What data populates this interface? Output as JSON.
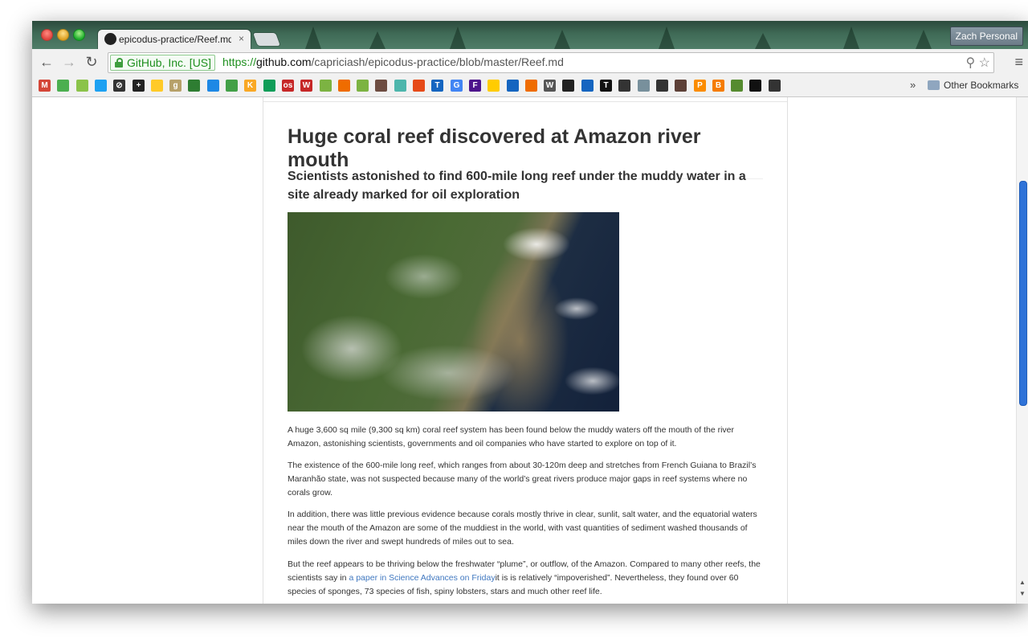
{
  "tab": {
    "title": "epicodus-practice/Reef.md",
    "close": "×"
  },
  "profile": {
    "label": "Zach Personal"
  },
  "toolbar": {
    "back": "←",
    "forward": "→",
    "reload": "↻",
    "menu": "≡"
  },
  "address": {
    "ev_label": "GitHub, Inc. [US]",
    "scheme": "https://",
    "host": "github.com",
    "path": "/capriciash/epicodus-practice/blob/master/Reef.md",
    "icons": "⚲ ☆"
  },
  "bookmarks": {
    "items": [
      {
        "name": "gmail",
        "glyph": "M",
        "color": "#d44638"
      },
      {
        "name": "maps",
        "glyph": "",
        "color": "#4caf50"
      },
      {
        "name": "android",
        "glyph": "",
        "color": "#8bc34a"
      },
      {
        "name": "twitter",
        "glyph": "",
        "color": "#1da1f2"
      },
      {
        "name": "circle-slash",
        "glyph": "⊘",
        "color": "#333"
      },
      {
        "name": "plus-app",
        "glyph": "+",
        "color": "#222"
      },
      {
        "name": "yellow-app",
        "glyph": "",
        "color": "#ffca28"
      },
      {
        "name": "goodreads",
        "glyph": "g",
        "color": "#b7a16a"
      },
      {
        "name": "green-book",
        "glyph": "",
        "color": "#2e7d32"
      },
      {
        "name": "blue-square",
        "glyph": "",
        "color": "#1e88e5"
      },
      {
        "name": "evernote",
        "glyph": "",
        "color": "#43a047"
      },
      {
        "name": "kmd",
        "glyph": "K",
        "color": "#f9a825"
      },
      {
        "name": "sheets",
        "glyph": "",
        "color": "#0f9d58"
      },
      {
        "name": "os-app",
        "glyph": "os",
        "color": "#c62828"
      },
      {
        "name": "w-red",
        "glyph": "W",
        "color": "#c62828"
      },
      {
        "name": "arc-app",
        "glyph": "",
        "color": "#7cb342"
      },
      {
        "name": "fox-app",
        "glyph": "",
        "color": "#ef6c00"
      },
      {
        "name": "shopify",
        "glyph": "",
        "color": "#7cb342"
      },
      {
        "name": "bird-app",
        "glyph": "",
        "color": "#6d4c41"
      },
      {
        "name": "cloud-app",
        "glyph": "",
        "color": "#4db6ac"
      },
      {
        "name": "spiral-app",
        "glyph": "",
        "color": "#e64a19"
      },
      {
        "name": "tl-app",
        "glyph": "T",
        "color": "#1565c0"
      },
      {
        "name": "google",
        "glyph": "G",
        "color": "#4285f4"
      },
      {
        "name": "fedex",
        "glyph": "F",
        "color": "#4d148c"
      },
      {
        "name": "dhl",
        "glyph": "",
        "color": "#ffcc00"
      },
      {
        "name": "mail-app",
        "glyph": "",
        "color": "#1565c0"
      },
      {
        "name": "box-app",
        "glyph": "",
        "color": "#ef6c00"
      },
      {
        "name": "wikipedia",
        "glyph": "W",
        "color": "#555"
      },
      {
        "name": "circle-app",
        "glyph": "",
        "color": "#222"
      },
      {
        "name": "robot-app",
        "glyph": "",
        "color": "#1565c0"
      },
      {
        "name": "nyt",
        "glyph": "T",
        "color": "#111"
      },
      {
        "name": "pin-app",
        "glyph": "",
        "color": "#333"
      },
      {
        "name": "slash-app",
        "glyph": "",
        "color": "#78909c"
      },
      {
        "name": "bike-app",
        "glyph": "",
        "color": "#333"
      },
      {
        "name": "stamp-app",
        "glyph": "",
        "color": "#5d4037"
      },
      {
        "name": "p-app",
        "glyph": "P",
        "color": "#fb8c00"
      },
      {
        "name": "blogger",
        "glyph": "B",
        "color": "#f57c00"
      },
      {
        "name": "puzzle-app",
        "glyph": "",
        "color": "#558b2f"
      },
      {
        "name": "black-square",
        "glyph": "",
        "color": "#111"
      },
      {
        "name": "octocat",
        "glyph": "",
        "color": "#333"
      }
    ],
    "more": "»",
    "other_label": "Other Bookmarks"
  },
  "article": {
    "title": "Huge coral reef discovered at Amazon river mouth",
    "subtitle": "Scientists astonished to find 600-mile long reef under the muddy water in a site already marked for oil exploration",
    "image_alt": "Satellite view of the Amazon river mouth",
    "p1": "A huge 3,600 sq mile (9,300 sq km) coral reef system has been found below the muddy waters off the mouth of the river Amazon, astonishing scientists, governments and oil companies who have started to explore on top of it.",
    "p2": "The existence of the 600-mile long reef, which ranges from about 30-120m deep and stretches from French Guiana to Brazil’s Maranhão state, was not suspected because many of the world’s great rivers produce major gaps in reef systems where no corals grow.",
    "p3": "In addition, there was little previous evidence because corals mostly thrive in clear, sunlit, salt water, and the equatorial waters near the mouth of the Amazon are some of the muddiest in the world, with vast quantities of sediment washed thousands of miles down the river and swept hundreds of miles out to sea.",
    "p4_before": "But the reef appears to be thriving below the freshwater “plume”, or outflow, of the Amazon. Compared to many other reefs, the scientists say in ",
    "p4_link": "a paper in Science Advances on Friday",
    "p4_after": "it is is relatively “impoverished”. Nevertheless, they found over 60 species of sponges, 73 species of fish, spiny lobsters, stars and much other reef life."
  },
  "scroll": {
    "up": "▲",
    "down": "▼"
  }
}
